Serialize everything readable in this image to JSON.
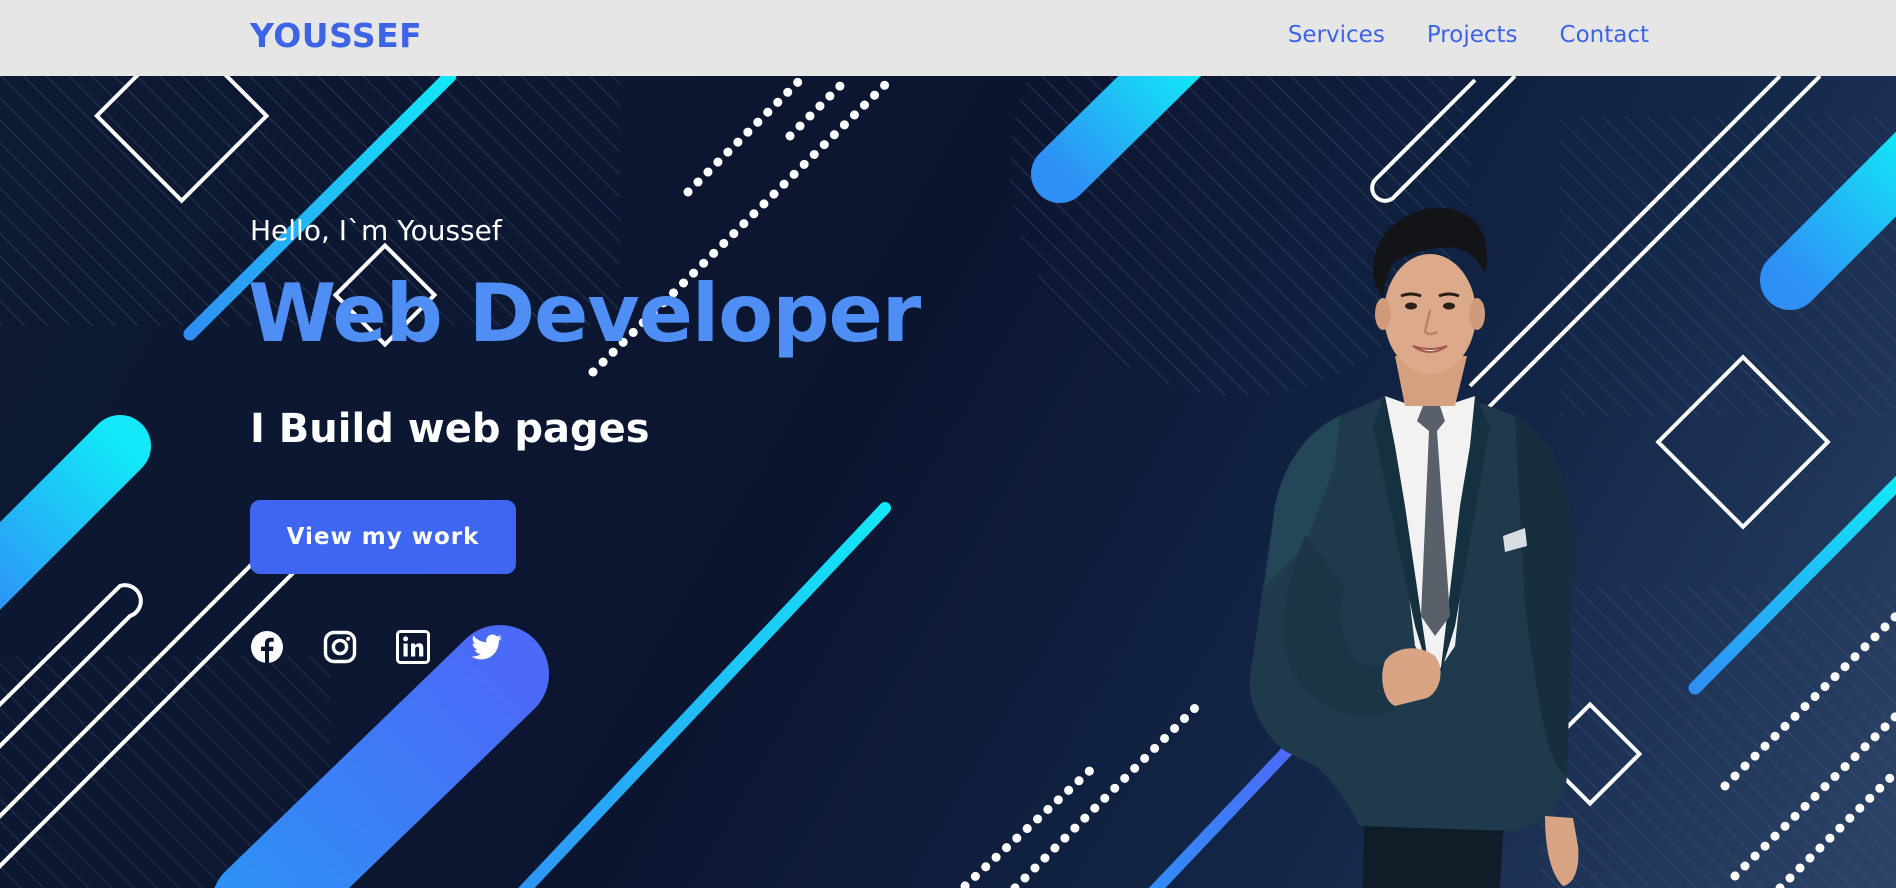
{
  "navbar": {
    "logo": "YOUSSEF",
    "links": [
      {
        "label": "Services"
      },
      {
        "label": "Projects"
      },
      {
        "label": "Contact"
      }
    ]
  },
  "hero": {
    "greeting": "Hello, I`m Youssef",
    "title": "Web Developer",
    "subtitle": "I Build web pages",
    "cta_label": "View my work",
    "socials": [
      "facebook-icon",
      "instagram-icon",
      "linkedin-icon",
      "twitter-icon"
    ]
  },
  "colors": {
    "accent": "#3d63e6",
    "title": "#4f8ff5",
    "nav_background": "#e6e6e6",
    "hero_background": "#0b1530",
    "cyan": "#12e0f5",
    "button": "#3e66f0"
  }
}
